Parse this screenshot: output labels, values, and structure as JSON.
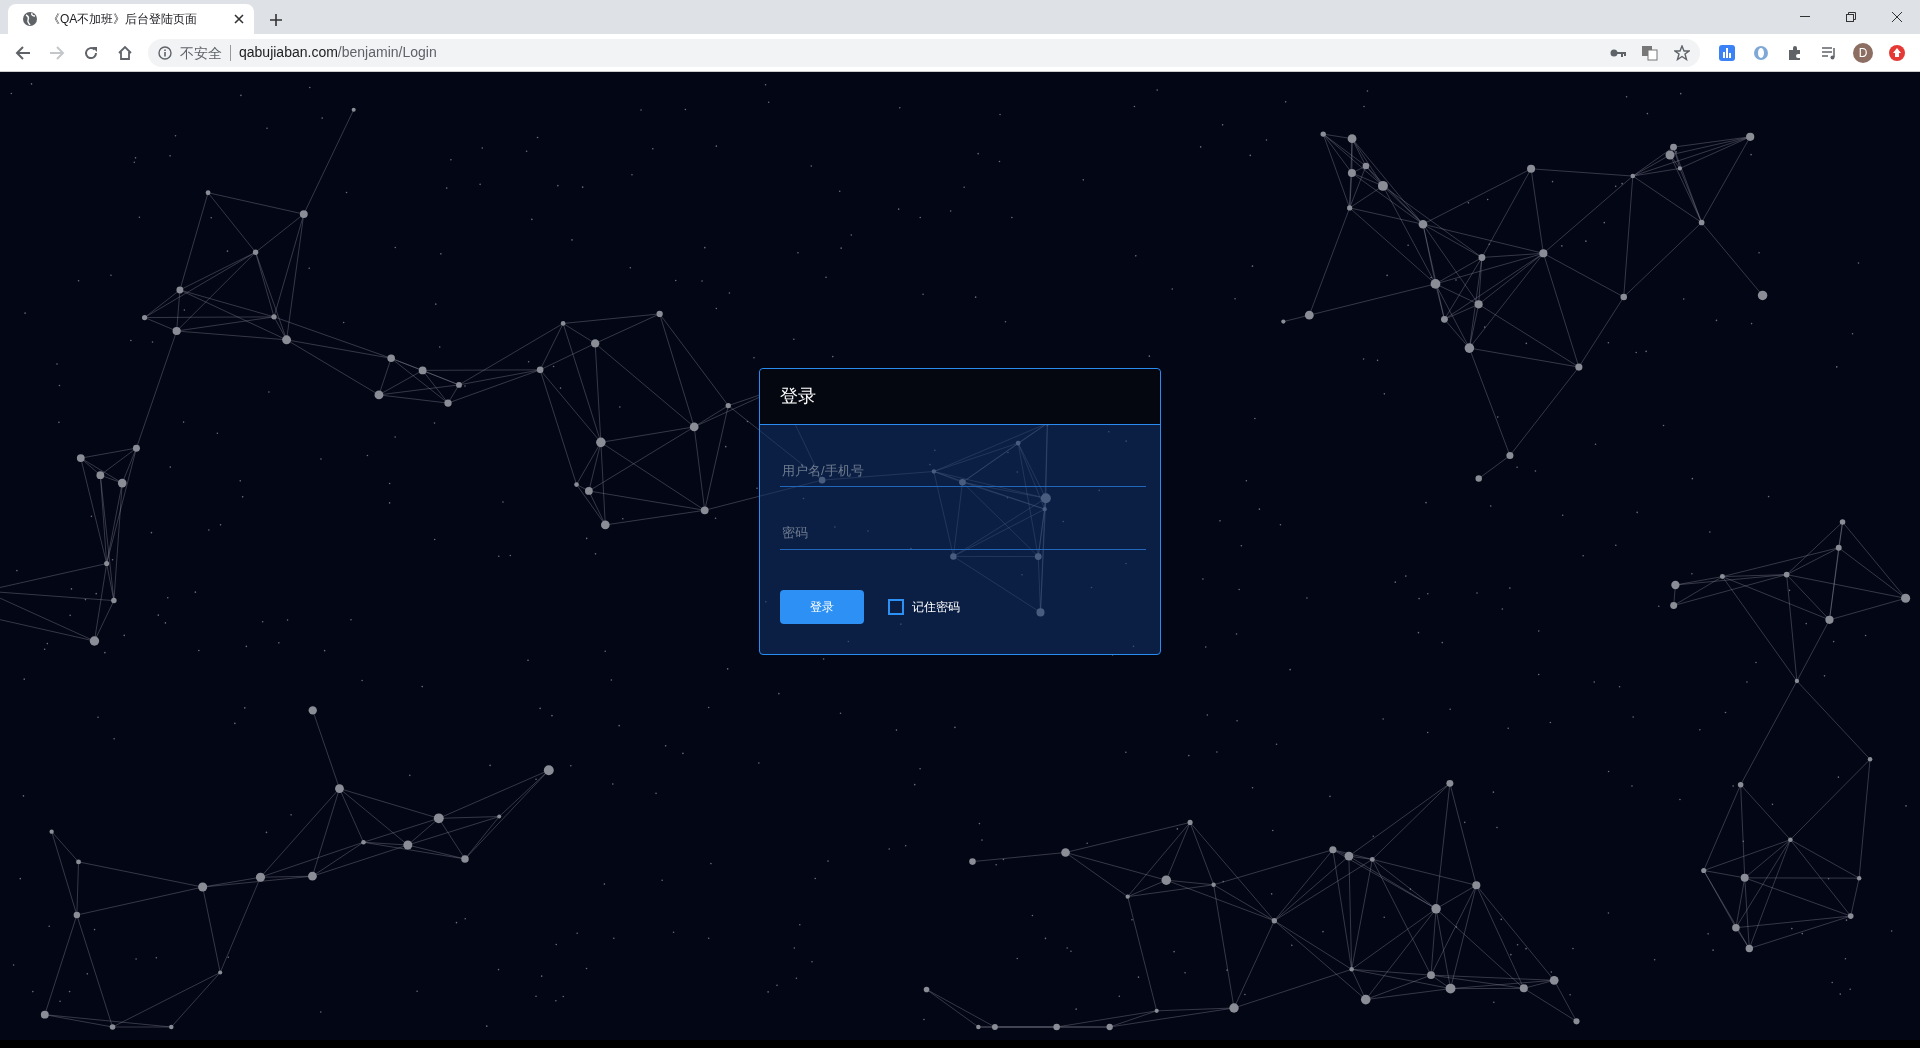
{
  "browser": {
    "tab": {
      "title": "《QA不加班》后台登陆页面"
    },
    "nav": {
      "forward_disabled": true
    },
    "address_bar": {
      "security_label": "不安全",
      "url_host": "qabujiaban.com",
      "url_path": "/benjamin/Login"
    },
    "profile_initial": "D"
  },
  "login": {
    "title": "登录",
    "fields": [
      {
        "placeholder": "用户名/手机号"
      },
      {
        "placeholder": "密码"
      }
    ],
    "submit": "登录",
    "remember": {
      "label": "记住密码",
      "checked": false
    }
  }
}
